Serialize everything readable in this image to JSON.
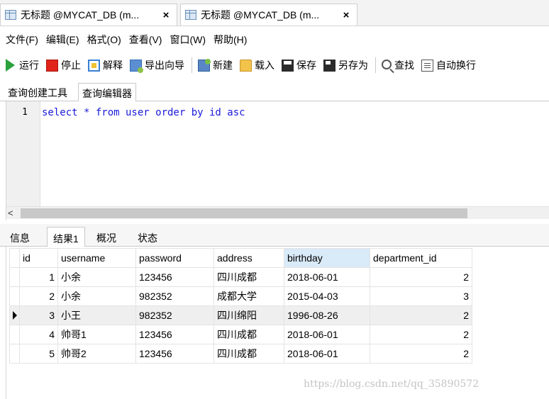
{
  "doc_tabs": [
    {
      "title": "无标题 @MYCAT_DB (m...",
      "close": "×"
    },
    {
      "title": "无标题 @MYCAT_DB (m...",
      "close": "×"
    }
  ],
  "menu": [
    "文件(F)",
    "编辑(E)",
    "格式(O)",
    "查看(V)",
    "窗口(W)",
    "帮助(H)"
  ],
  "toolbar": {
    "run": "运行",
    "stop": "停止",
    "explain": "解释",
    "export": "导出向导",
    "new": "新建",
    "load": "载入",
    "save": "保存",
    "saveas": "另存为",
    "find": "查找",
    "wrap": "自动换行"
  },
  "sub_tabs": [
    "查询创建工具",
    "查询编辑器"
  ],
  "editor": {
    "line_number": "1",
    "code": "select * from user order by id asc",
    "scroll_left_arrow": "<"
  },
  "result_tabs": [
    "信息",
    "结果1",
    "概况",
    "状态"
  ],
  "grid": {
    "columns": [
      "id",
      "username",
      "password",
      "address",
      "birthday",
      "department_id"
    ],
    "selected_column": "birthday",
    "current_row_index": 2,
    "rows": [
      [
        "1",
        "小余",
        "123456",
        "四川成都",
        "2018-06-01",
        "2"
      ],
      [
        "2",
        "小余",
        "982352",
        "成都大学",
        "2015-04-03",
        "3"
      ],
      [
        "3",
        "小王",
        "982352",
        "四川绵阳",
        "1996-08-26",
        "2"
      ],
      [
        "4",
        "帅哥1",
        "123456",
        "四川成都",
        "2018-06-01",
        "2"
      ],
      [
        "5",
        "帅哥2",
        "123456",
        "四川成都",
        "2018-06-01",
        "2"
      ]
    ]
  },
  "watermark": "https://blog.csdn.net/qq_35890572",
  "icons": [
    "table-icon",
    "run-icon",
    "stop-icon",
    "explain-icon",
    "export-icon",
    "new-icon",
    "load-icon",
    "save-icon",
    "saveas-icon",
    "find-icon",
    "wrap-icon",
    "row-pointer-icon"
  ]
}
